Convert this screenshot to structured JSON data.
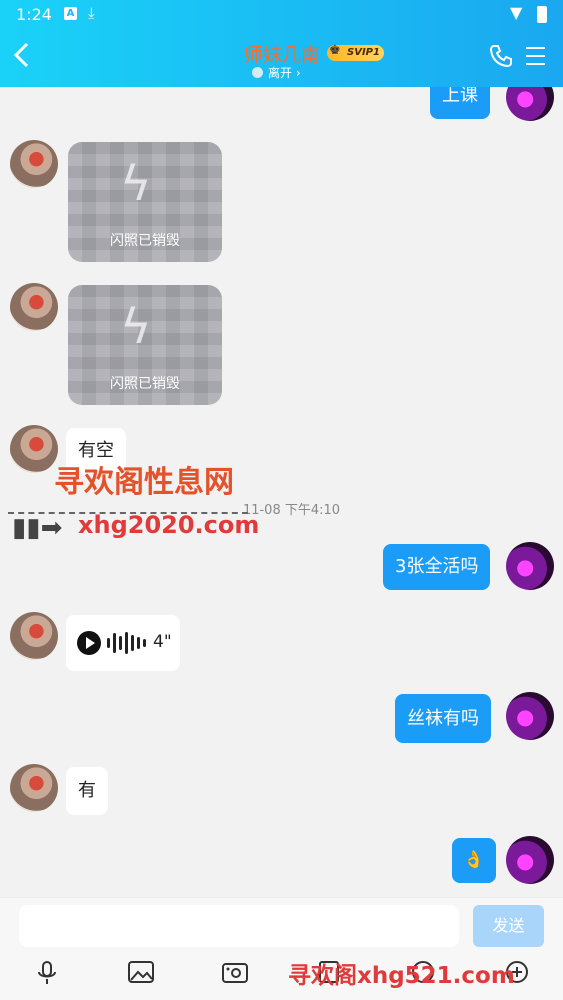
{
  "status_bar": {
    "time": "1:24",
    "a_icon": "A"
  },
  "header": {
    "title": "师妹几南",
    "vip_badge": "SVIP1",
    "status": "离开",
    "status_chevron": "›"
  },
  "messages": {
    "m1": "上课",
    "flash1_label": "闪照已销毁",
    "flash2_label": "闪照已销毁",
    "m2": "有空",
    "timestamp": "11-08 下午4:10",
    "m3": "3张全活吗",
    "voice_duration": "4\"",
    "m4": "丝袜有吗",
    "m5": "有",
    "m6": "👌"
  },
  "watermarks": {
    "w1": "寻欢阁性息网",
    "w2": "xhg2020.com",
    "w3": "寻欢阁xhg521.com"
  },
  "input": {
    "placeholder": "",
    "send_label": "发送"
  },
  "colors": {
    "accent": "#1a9cf7",
    "header_start": "#1ad2f8",
    "header_end": "#1aa8f0",
    "title": "#ff6a2a"
  }
}
